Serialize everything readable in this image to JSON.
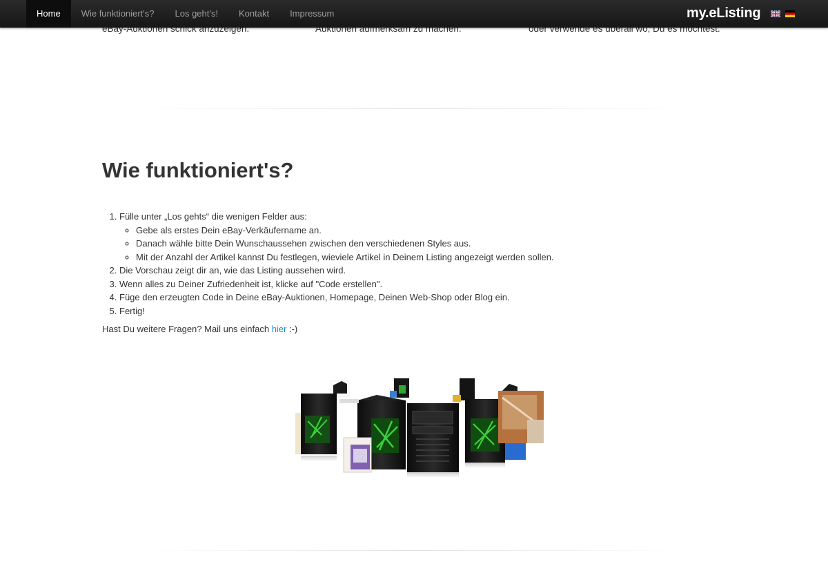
{
  "nav": {
    "items": [
      {
        "label": "Home",
        "active": true
      },
      {
        "label": "Wie funktioniert's?"
      },
      {
        "label": "Los geht's!"
      },
      {
        "label": "Kontakt"
      },
      {
        "label": "Impressum"
      }
    ],
    "brand": "my.eListing",
    "languages": [
      "uk-flag-icon",
      "de-flag-icon"
    ]
  },
  "features": {
    "col1_tail": "eBay-Auktionen schick anzuzeigen.",
    "col2_tail": "Auktionen aufmerksam zu machen.",
    "col3_tail": "oder verwende es überall wo, Du es möchtest."
  },
  "how": {
    "title": "Wie funktioniert's?",
    "step1": "Fülle unter „Los gehts“ die wenigen Felder aus:",
    "step1_sub": [
      "Gebe als erstes Dein eBay-Verkäufername an.",
      "Danach wähle bitte Dein Wunschaussehen zwischen den verschiedenen Styles aus.",
      "Mit der Anzahl der Artikel kannst Du festlegen, wieviele Artikel in Deinem Listing angezeigt werden sollen."
    ],
    "step2": "Die Vorschau zeigt dir an, wie das Listing aussehen wird.",
    "step3": "Wenn alles zu Deiner Zufriedenheit ist, klicke auf \"Code erstellen\".",
    "step4": "Füge den erzeugten Code in Deine eBay-Auktionen, Homepage, Deinen Web-Shop oder Blog ein.",
    "step5": "Fertig!",
    "question_prefix": "Hast Du weitere Fragen? Mail uns einfach ",
    "question_link": "hier",
    "question_suffix": " :-)"
  },
  "colors": {
    "accent": "#1a8fd2",
    "nav_bg": "#1b1b1b",
    "pc_glow": "#3cd23c"
  }
}
